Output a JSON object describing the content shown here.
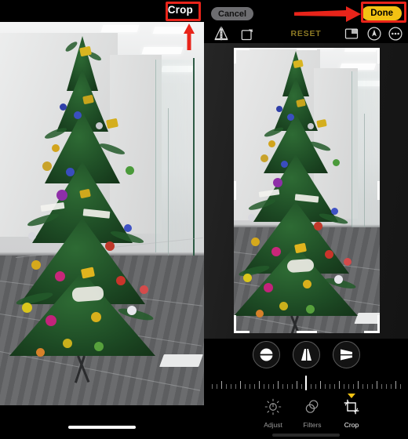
{
  "left_panel": {
    "crop_button": "Crop",
    "annotation": {
      "highlight_color": "#e8241a",
      "arrow": "arrow-up-red"
    },
    "photo": {
      "alt": "Decorated Christmas tree in an office near a glass partition",
      "subject": "christmas-tree"
    }
  },
  "right_panel": {
    "cancel_button": "Cancel",
    "done_button": "Done",
    "reset_label": "RESET",
    "annotation": {
      "highlight_color": "#e8241a",
      "arrow": "arrow-right-red"
    },
    "tools": [
      {
        "name": "flip-horizontal-icon",
        "label": "Flip"
      },
      {
        "name": "rotate-icon",
        "label": "Rotate"
      },
      {
        "name": "aspect-ratio-icon",
        "label": "Aspect Ratio"
      },
      {
        "name": "markup-icon",
        "label": "Markup"
      },
      {
        "name": "more-options-icon",
        "label": "More"
      }
    ],
    "perspective_buttons": [
      {
        "name": "straighten-button",
        "label": "Straighten"
      },
      {
        "name": "vertical-perspective-button",
        "label": "Vertical"
      },
      {
        "name": "horizontal-perspective-button",
        "label": "Horizontal"
      }
    ],
    "slider": {
      "name": "straighten-slider",
      "value": 0,
      "min": -45,
      "max": 45
    },
    "tabs": [
      {
        "label": "Adjust",
        "icon": "brightness-icon",
        "selected": false
      },
      {
        "label": "Filters",
        "icon": "filters-icon",
        "selected": false
      },
      {
        "label": "Crop",
        "icon": "crop-icon",
        "selected": true
      }
    ]
  },
  "colors": {
    "accent_yellow": "#f2c213",
    "highlight_red": "#e8241a",
    "reset_dim": "#8d7a24",
    "background": "#000000"
  }
}
